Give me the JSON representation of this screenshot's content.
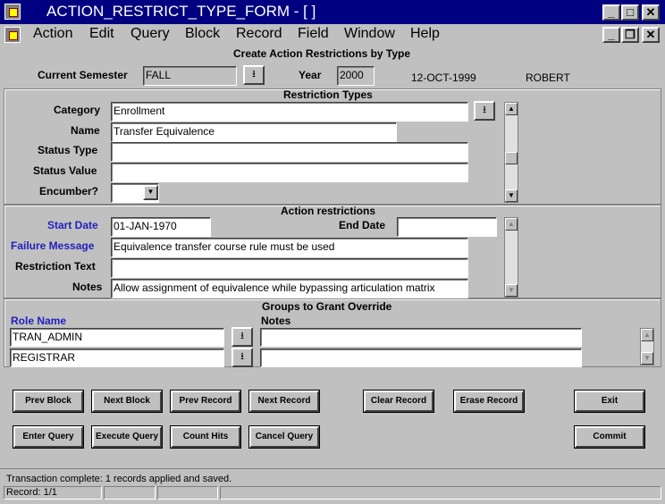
{
  "window": {
    "title": "ACTION_RESTRICT_TYPE_FORM - [ ]"
  },
  "menu": [
    "Action",
    "Edit",
    "Query",
    "Block",
    "Record",
    "Field",
    "Window",
    "Help"
  ],
  "form": {
    "header": "Create Action Restrictions by Type",
    "semester_label": "Current Semester",
    "semester_value": "FALL",
    "year_label": "Year",
    "year_value": "2000",
    "date": "12-OCT-1999",
    "user": "ROBERT"
  },
  "restriction_types": {
    "title": "Restriction Types",
    "category_label": "Category",
    "category_value": "Enrollment",
    "name_label": "Name",
    "name_value": "Transfer Equivalence",
    "status_type_label": "Status Type",
    "status_type_value": "",
    "status_value_label": "Status Value",
    "status_value_value": "",
    "encumber_label": "Encumber?",
    "encumber_value": ""
  },
  "action_restrictions": {
    "title": "Action restrictions",
    "start_date_label": "Start Date",
    "start_date_value": "01-JAN-1970",
    "end_date_label": "End Date",
    "end_date_value": "",
    "failure_label": "Failure Message",
    "failure_value": "Equivalence transfer course rule must be used",
    "restriction_text_label": "Restriction Text",
    "restriction_text_value": "",
    "notes_label": "Notes",
    "notes_value": "Allow assignment of equivalence while bypassing articulation matrix"
  },
  "groups": {
    "title": "Groups to Grant Override",
    "role_header": "Role Name",
    "notes_header": "Notes",
    "rows": [
      {
        "role": "TRAN_ADMIN",
        "notes": ""
      },
      {
        "role": "REGISTRAR",
        "notes": ""
      }
    ]
  },
  "buttons": {
    "prev_block": "Prev Block",
    "next_block": "Next Block",
    "prev_record": "Prev Record",
    "next_record": "Next Record",
    "clear_record": "Clear Record",
    "erase_record": "Erase Record",
    "exit": "Exit",
    "enter_query": "Enter Query",
    "execute_query": "Execute Query",
    "count_hits": "Count Hits",
    "cancel_query": "Cancel Query",
    "commit": "Commit"
  },
  "status": {
    "message": "Transaction complete: 1 records applied and saved.",
    "record": "Record: 1/1"
  },
  "colors": {
    "titlebar": "#000080",
    "chrome": "#c0c0c0",
    "required_label": "#1f1fbf"
  }
}
